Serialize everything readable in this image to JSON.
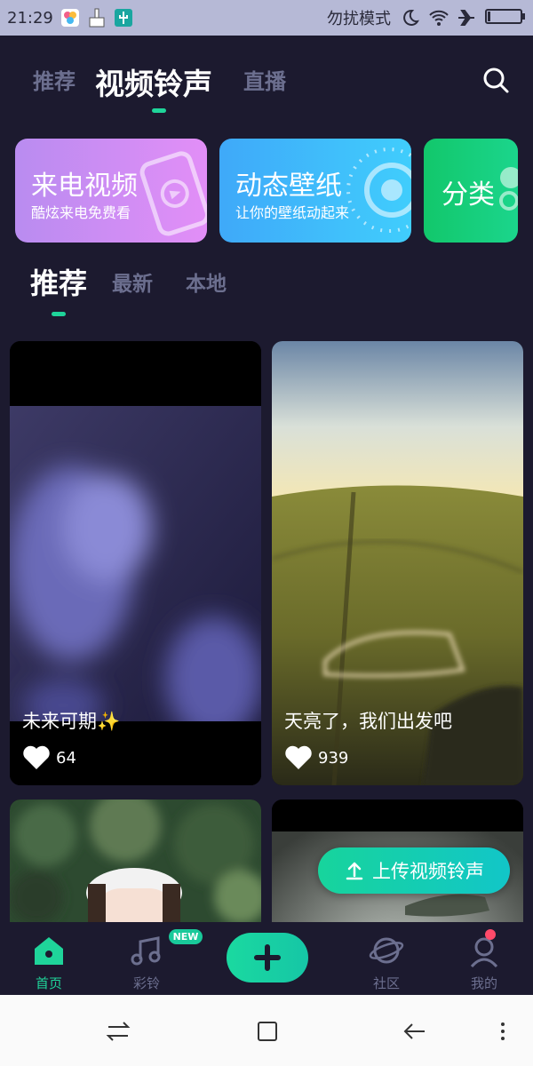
{
  "status_bar": {
    "time": "21:29",
    "mode_text": "勿扰模式",
    "icons": [
      "app-notification-icon",
      "broom-icon",
      "usb-icon",
      "moon-icon",
      "wifi-icon",
      "airplane-icon",
      "battery-icon"
    ]
  },
  "header": {
    "tabs": [
      {
        "label": "推荐",
        "active": false
      },
      {
        "label": "视频铃声",
        "active": true
      },
      {
        "label": "直播",
        "active": false
      }
    ],
    "search_icon": "search-icon"
  },
  "cards": [
    {
      "title": "来电视频",
      "subtitle": "酷炫来电免费看",
      "color_start": "#b98cf0",
      "color_end": "#e28ef7"
    },
    {
      "title": "动态壁纸",
      "subtitle": "让你的壁纸动起来",
      "color_start": "#3fa9f9",
      "color_end": "#40cdfc"
    },
    {
      "title": "分类",
      "subtitle": "",
      "color_start": "#12c76b",
      "color_end": "#1bd58c"
    }
  ],
  "sub_tabs": [
    {
      "label": "推荐",
      "active": true
    },
    {
      "label": "最新",
      "active": false
    },
    {
      "label": "本地",
      "active": false
    }
  ],
  "videos": [
    {
      "title": "未来可期✨",
      "likes": "64"
    },
    {
      "title": "天亮了，我们出发吧",
      "likes": "939"
    },
    {
      "title": "",
      "likes": ""
    },
    {
      "title": "",
      "likes": ""
    }
  ],
  "upload_button": {
    "label": "上传视频铃声",
    "icon": "upload-icon"
  },
  "bottom_nav": {
    "items": [
      {
        "label": "首页",
        "icon": "home-icon",
        "active": true
      },
      {
        "label": "彩铃",
        "icon": "music-note-icon",
        "active": false
      },
      {
        "label": "",
        "icon": "plus-icon",
        "active": false
      },
      {
        "label": "社区",
        "icon": "planet-icon",
        "active": false
      },
      {
        "label": "我的",
        "icon": "profile-icon",
        "active": false
      }
    ],
    "new_badge": "NEW"
  },
  "colors": {
    "background": "#1c1a2f",
    "accent": "#1fd49a",
    "inactive_text": "#6c6f8f",
    "status_bar": "#b6b9d6"
  }
}
